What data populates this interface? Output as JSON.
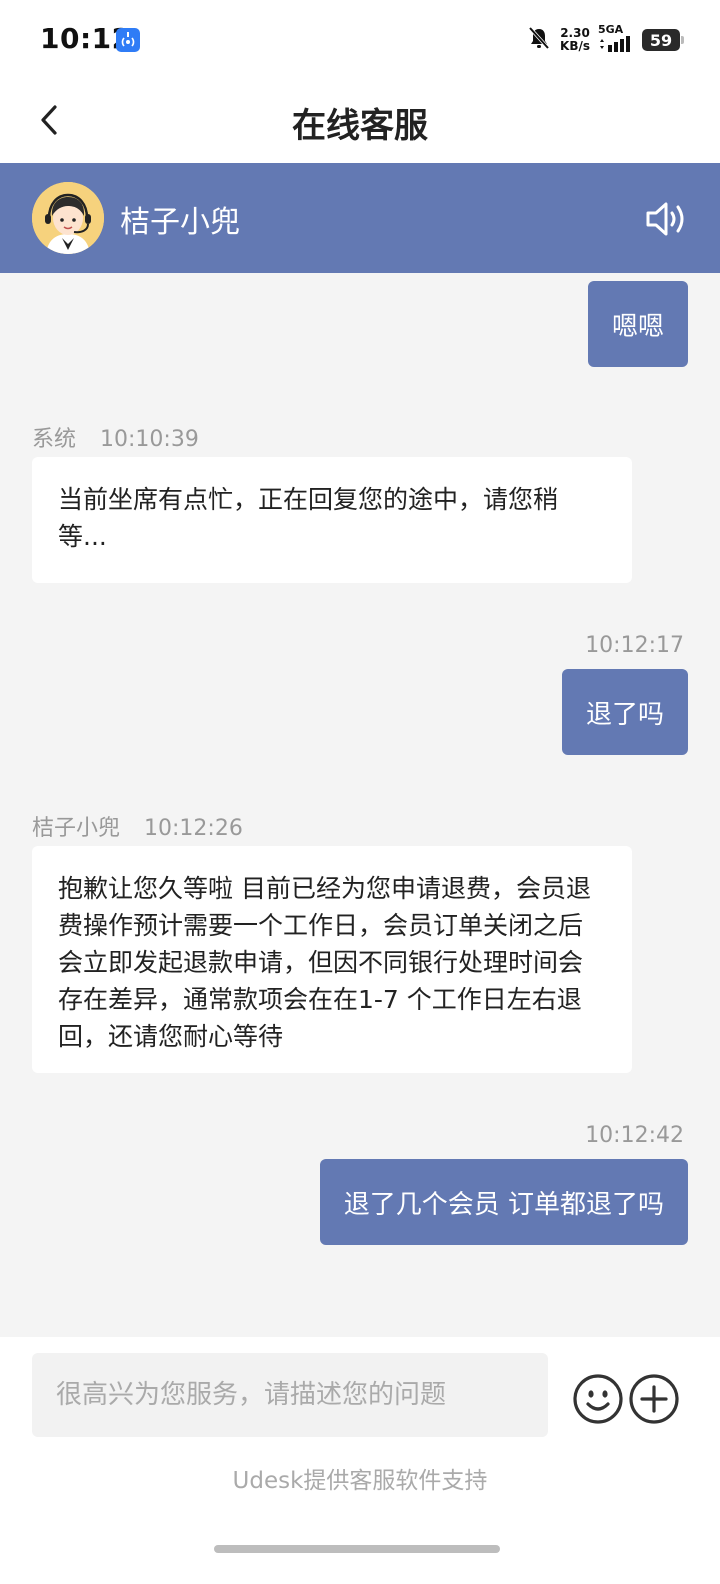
{
  "status_bar": {
    "time": "10:12",
    "speed_value": "2.30",
    "speed_unit": "KB/s",
    "network": "5GA",
    "battery": "59"
  },
  "title_bar": {
    "title": "在线客服"
  },
  "agent": {
    "name": "桔子小兜"
  },
  "messages": [
    {
      "side": "right",
      "text": "嗯嗯"
    },
    {
      "side": "left",
      "sender": "系统",
      "time": "10:10:39",
      "text": "当前坐席有点忙，正在回复您的途中，请您稍等..."
    },
    {
      "side": "right",
      "time": "10:12:17",
      "text": "退了吗"
    },
    {
      "side": "left",
      "sender": "桔子小兜",
      "time": "10:12:26",
      "text": "抱歉让您久等啦 目前已经为您申请退费，会员退费操作预计需要一个工作日，会员订单关闭之后会立即发起退款申请，但因不同银行处理时间会存在差异，通常款项会在在1-7 个工作日左右退回，还请您耐心等待"
    },
    {
      "side": "right",
      "time": "10:12:42",
      "text": "退了几个会员 订单都退了吗"
    }
  ],
  "input": {
    "placeholder": "很高兴为您服务，请描述您的问题",
    "value": ""
  },
  "footer": {
    "powered_by": "Udesk提供客服软件支持"
  },
  "colors": {
    "accent": "#6379b3",
    "background": "#f4f4f4"
  },
  "icons": {
    "back": "back-icon",
    "speaker": "speaker-icon",
    "emoji": "emoji-icon",
    "plus": "plus-icon",
    "mute": "bell-off-icon"
  }
}
